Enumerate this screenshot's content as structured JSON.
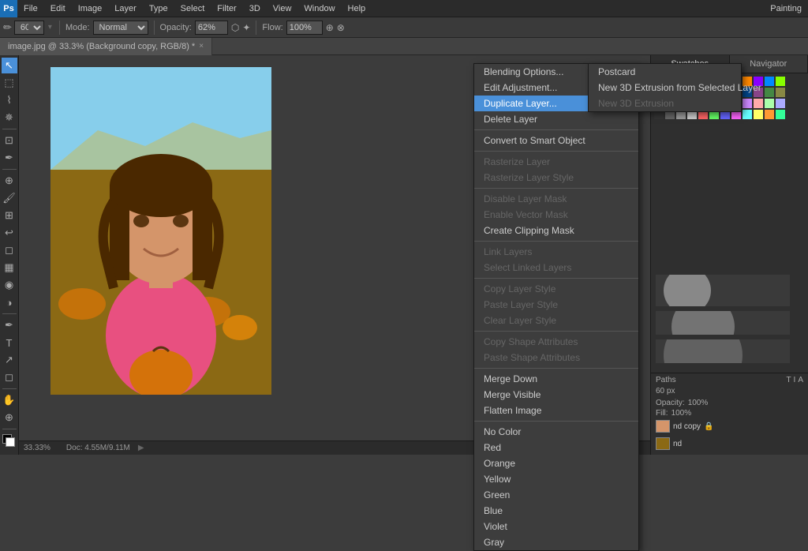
{
  "app": {
    "title": "Adobe Photoshop",
    "workspace": "Painting"
  },
  "menubar": {
    "items": [
      "PS",
      "File",
      "Edit",
      "Image",
      "Layer",
      "Type",
      "Select",
      "Filter",
      "3D",
      "View",
      "Window",
      "Help"
    ]
  },
  "toolbar": {
    "mode_label": "Mode:",
    "mode_value": "Normal",
    "opacity_label": "Opacity:",
    "opacity_value": "62%",
    "flow_label": "Flow:",
    "flow_value": "100%"
  },
  "tab": {
    "filename": "image.jpg @ 33.3% (Background copy, RGB/8) *",
    "close_symbol": "×"
  },
  "canvas": {
    "zoom": "33.33%",
    "doc_info": "Doc: 4.55M/9.11M"
  },
  "context_menu": {
    "items": [
      {
        "id": "blending-options",
        "label": "Blending Options...",
        "disabled": false,
        "highlighted": false
      },
      {
        "id": "edit-adjustment",
        "label": "Edit Adjustment...",
        "disabled": false,
        "highlighted": false
      },
      {
        "id": "duplicate-layer",
        "label": "Duplicate Layer...",
        "disabled": false,
        "highlighted": true
      },
      {
        "id": "delete-layer",
        "label": "Delete Layer",
        "disabled": false,
        "highlighted": false
      },
      {
        "id": "sep1",
        "type": "separator"
      },
      {
        "id": "convert-smart-object",
        "label": "Convert to Smart Object",
        "disabled": false,
        "highlighted": false
      },
      {
        "id": "sep2",
        "type": "separator"
      },
      {
        "id": "rasterize-layer",
        "label": "Rasterize Layer",
        "disabled": true,
        "highlighted": false
      },
      {
        "id": "rasterize-layer-style",
        "label": "Rasterize Layer Style",
        "disabled": true,
        "highlighted": false
      },
      {
        "id": "sep3",
        "type": "separator"
      },
      {
        "id": "disable-layer-mask",
        "label": "Disable Layer Mask",
        "disabled": true,
        "highlighted": false
      },
      {
        "id": "enable-vector-mask",
        "label": "Enable Vector Mask",
        "disabled": true,
        "highlighted": false
      },
      {
        "id": "create-clipping-mask",
        "label": "Create Clipping Mask",
        "disabled": false,
        "highlighted": false
      },
      {
        "id": "sep4",
        "type": "separator"
      },
      {
        "id": "link-layers",
        "label": "Link Layers",
        "disabled": true,
        "highlighted": false
      },
      {
        "id": "select-linked-layers",
        "label": "Select Linked Layers",
        "disabled": true,
        "highlighted": false
      },
      {
        "id": "sep5",
        "type": "separator"
      },
      {
        "id": "copy-layer-style",
        "label": "Copy Layer Style",
        "disabled": true,
        "highlighted": false
      },
      {
        "id": "paste-layer-style",
        "label": "Paste Layer Style",
        "disabled": true,
        "highlighted": false
      },
      {
        "id": "clear-layer-style",
        "label": "Clear Layer Style",
        "disabled": true,
        "highlighted": false
      },
      {
        "id": "sep6",
        "type": "separator"
      },
      {
        "id": "copy-shape-attributes",
        "label": "Copy Shape Attributes",
        "disabled": true,
        "highlighted": false
      },
      {
        "id": "paste-shape-attributes",
        "label": "Paste Shape Attributes",
        "disabled": true,
        "highlighted": false
      },
      {
        "id": "sep7",
        "type": "separator"
      },
      {
        "id": "merge-down",
        "label": "Merge Down",
        "disabled": false,
        "highlighted": false
      },
      {
        "id": "merge-visible",
        "label": "Merge Visible",
        "disabled": false,
        "highlighted": false
      },
      {
        "id": "flatten-image",
        "label": "Flatten Image",
        "disabled": false,
        "highlighted": false
      },
      {
        "id": "sep8",
        "type": "separator"
      },
      {
        "id": "no-color",
        "label": "No Color",
        "disabled": false,
        "highlighted": false
      },
      {
        "id": "red",
        "label": "Red",
        "disabled": false,
        "highlighted": false
      },
      {
        "id": "orange",
        "label": "Orange",
        "disabled": false,
        "highlighted": false
      },
      {
        "id": "yellow",
        "label": "Yellow",
        "disabled": false,
        "highlighted": false
      },
      {
        "id": "green",
        "label": "Green",
        "disabled": false,
        "highlighted": false
      },
      {
        "id": "blue",
        "label": "Blue",
        "disabled": false,
        "highlighted": false
      },
      {
        "id": "violet",
        "label": "Violet",
        "disabled": false,
        "highlighted": false
      },
      {
        "id": "gray",
        "label": "Gray",
        "disabled": false,
        "highlighted": false
      }
    ]
  },
  "secondary_menu": {
    "items": [
      {
        "id": "postcard",
        "label": "Postcard",
        "disabled": false
      },
      {
        "id": "new-3d-extrusion",
        "label": "New 3D Extrusion from Selected Layer",
        "disabled": false
      },
      {
        "id": "new-3d-extrusion-2",
        "label": "New 3D Extrusion",
        "disabled": true
      }
    ]
  },
  "swatches_panel": {
    "tabs": [
      "Swatches",
      "Navigator"
    ],
    "colors": [
      [
        "#000000",
        "#ffffff",
        "#ff0000",
        "#00ff00",
        "#0000ff",
        "#ffff00",
        "#ff00ff",
        "#00ffff",
        "#ff8800",
        "#8800ff",
        "#0088ff",
        "#88ff00"
      ],
      [
        "#cc0000",
        "#00cc00",
        "#0000cc",
        "#cccc00",
        "#cc00cc",
        "#00cccc",
        "#884400",
        "#448800",
        "#004488",
        "#884488",
        "#448844",
        "#888844"
      ],
      [
        "#ff9999",
        "#99ff99",
        "#9999ff",
        "#ffff99",
        "#ff99ff",
        "#99ffff",
        "#ffcc88",
        "#88ffcc",
        "#cc88ff",
        "#ffaaaa",
        "#aaffaa",
        "#aaaaff"
      ],
      [
        "#333333",
        "#666666",
        "#999999",
        "#cccccc",
        "#ff6666",
        "#66ff66",
        "#6666ff",
        "#ff66ff",
        "#66ffff",
        "#ffff66",
        "#ff9933",
        "#33ff99"
      ]
    ]
  },
  "panels": {
    "paths_label": "Paths",
    "size_label": "60 px",
    "opacity_label": "Opacity:",
    "opacity_value": "100%",
    "fill_label": "Fill:",
    "fill_value": "100%",
    "layer_name": "nd copy",
    "layer_name2": "nd"
  },
  "tools": {
    "foreground_color": "#000000",
    "background_color": "#ffffff"
  }
}
